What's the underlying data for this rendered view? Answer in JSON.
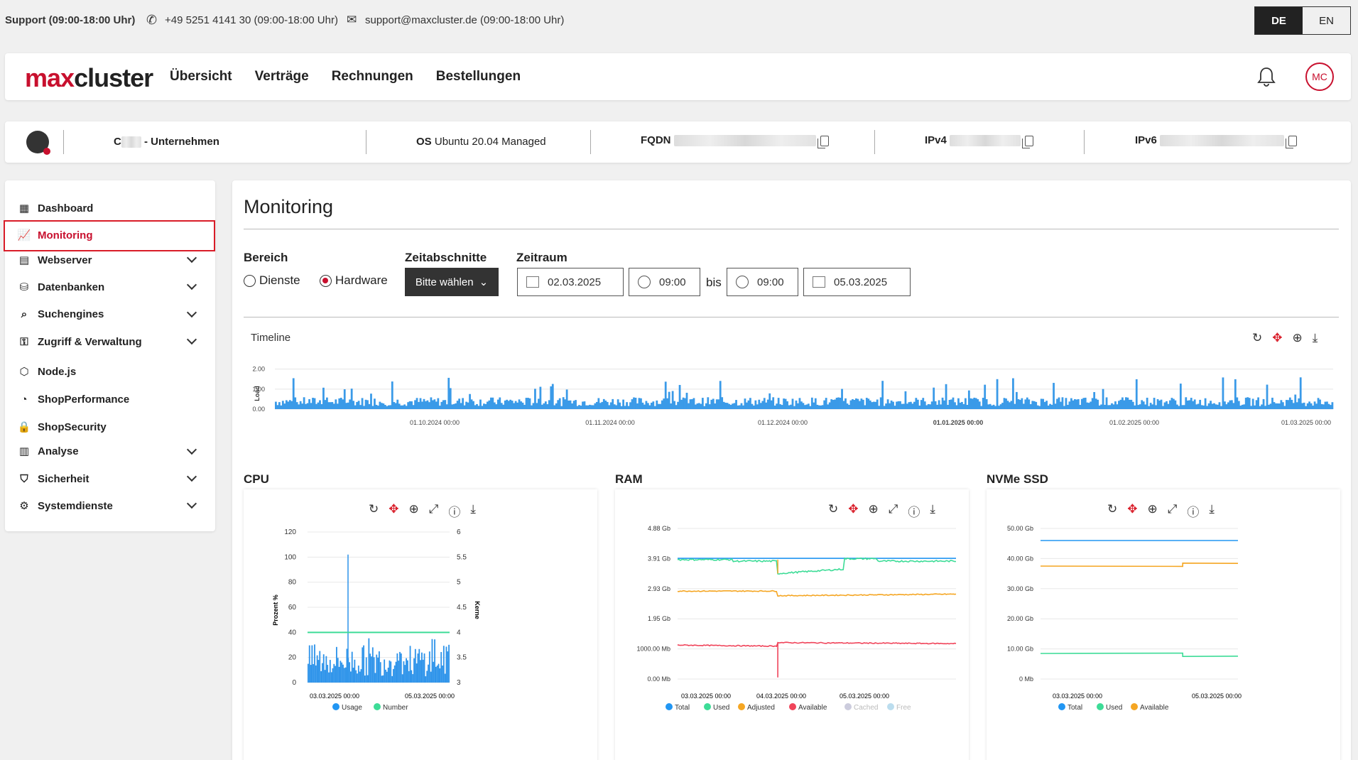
{
  "topbar": {
    "support": "Support (09:00-18:00 Uhr)",
    "phone": "+49 5251 4141 30 (09:00-18:00 Uhr)",
    "email": "support@maxcluster.de (09:00-18:00 Uhr)",
    "lang_de": "DE",
    "lang_en": "EN"
  },
  "header": {
    "logo_max": "max",
    "logo_cluster": "cluster",
    "nav": [
      "Übersicht",
      "Verträge",
      "Rechnungen",
      "Bestellungen"
    ],
    "avatar": "MC"
  },
  "infobar": {
    "company_prefix": "C",
    "company": "- Unternehmen",
    "os_label": "OS",
    "os_value": "Ubuntu 20.04 Managed",
    "fqdn_label": "FQDN",
    "ipv4_label": "IPv4",
    "ipv6_label": "IPv6"
  },
  "sidebar": {
    "items": [
      {
        "label": "Dashboard",
        "icon": "dashboard-icon"
      },
      {
        "label": "Monitoring",
        "icon": "monitoring-icon",
        "active": true
      },
      {
        "label": "Webserver",
        "icon": "webserver-icon",
        "expandable": true
      },
      {
        "label": "Datenbanken",
        "icon": "database-icon",
        "expandable": true
      },
      {
        "label": "Suchengines",
        "icon": "search-icon",
        "expandable": true
      },
      {
        "label": "Zugriff & Verwaltung",
        "icon": "key-icon",
        "expandable": true
      },
      {
        "label": "Node.js",
        "icon": "nodejs-icon"
      },
      {
        "label": "ShopPerformance",
        "icon": "speedometer-icon"
      },
      {
        "label": "ShopSecurity",
        "icon": "lock-icon"
      },
      {
        "label": "Analyse",
        "icon": "analytics-icon",
        "expandable": true
      },
      {
        "label": "Sicherheit",
        "icon": "shield-icon",
        "expandable": true
      },
      {
        "label": "Systemdienste",
        "icon": "gear-icon",
        "expandable": true
      }
    ]
  },
  "main": {
    "title": "Monitoring",
    "bereich_label": "Bereich",
    "radio_dienste": "Dienste",
    "radio_hardware": "Hardware",
    "selected": "Hardware",
    "zeitabschnitte_label": "Zeitabschnitte",
    "zeitabschnitte_button": "Bitte wählen",
    "zeitraum_label": "Zeitraum",
    "date_from": "02.03.2025",
    "time_from": "09:00",
    "bis": "bis",
    "time_to": "09:00",
    "date_to": "05.03.2025",
    "timeline_title": "Timeline",
    "cpu_title": "CPU",
    "ram_title": "RAM",
    "ssd_title": "NVMe SSD"
  },
  "chart_data": [
    {
      "type": "bar",
      "title": "Timeline",
      "ylabel": "Load",
      "yticks": [
        "2.00",
        "1.00",
        "0.00"
      ],
      "ylim": [
        0,
        2.2
      ],
      "xticks": [
        "01.10.2024 00:00",
        "01.11.2024 00:00",
        "01.12.2024 00:00",
        "01.01.2025 00:00",
        "01.02.2025 00:00",
        "01.03.2025 00:00"
      ],
      "typical_range": [
        0.15,
        0.6
      ],
      "peaks": [
        1.4,
        1.5,
        1.3,
        1.45,
        1.6,
        1.35
      ]
    },
    {
      "type": "bar",
      "title": "CPU",
      "ylabel": "Prozent %",
      "y2label": "Kerne",
      "yticks": [
        "120",
        "100",
        "80",
        "60",
        "40",
        "20",
        "0"
      ],
      "y2ticks": [
        "6",
        "5.5",
        "5",
        "4.5",
        "4",
        "3.5",
        "3"
      ],
      "xticks": [
        "03.03.2025 00:00",
        "05.03.2025 00:00"
      ],
      "series": [
        {
          "name": "Usage",
          "color": "#2196f3",
          "typical": [
            5,
            30
          ],
          "spike": 102
        },
        {
          "name": "Number",
          "color": "#3ddc97",
          "value": 4
        }
      ]
    },
    {
      "type": "line",
      "title": "RAM",
      "yticks": [
        "4.88 Gb",
        "3.91 Gb",
        "2.93 Gb",
        "1.95 Gb",
        "1000.00 Mb",
        "0.00 Mb"
      ],
      "xticks": [
        "03.03.2025 00:00",
        "04.03.2025 00:00",
        "05.03.2025 00:00"
      ],
      "series": [
        {
          "name": "Total",
          "color": "#2196f3",
          "values": [
            3.91,
            3.91
          ]
        },
        {
          "name": "Used",
          "color": "#3ddc97",
          "values": [
            3.87,
            3.82,
            3.4,
            3.55,
            3.85,
            3.8
          ]
        },
        {
          "name": "Adjusted",
          "color": "#f5a623",
          "values": [
            2.85,
            2.85,
            2.7,
            2.72,
            2.75
          ]
        },
        {
          "name": "Available",
          "color": "#f0445a",
          "values": [
            1.1,
            1.05,
            1.2,
            1.15,
            1.15
          ]
        },
        {
          "name": "Cached",
          "color": "#ccd"
        },
        {
          "name": "Free",
          "color": "#bde"
        }
      ]
    },
    {
      "type": "line",
      "title": "NVMe SSD",
      "yticks": [
        "50.00 Gb",
        "40.00 Gb",
        "30.00 Gb",
        "20.00 Gb",
        "10.00 Gb",
        "0 Mb"
      ],
      "xticks": [
        "03.03.2025 00:00",
        "05.03.2025 00:00"
      ],
      "series": [
        {
          "name": "Total",
          "color": "#2196f3",
          "values": [
            46,
            46
          ]
        },
        {
          "name": "Used",
          "color": "#3ddc97",
          "values": [
            8.5,
            8.5,
            7.5
          ]
        },
        {
          "name": "Available",
          "color": "#f5a623",
          "values": [
            37.5,
            37.5,
            38.5
          ]
        }
      ]
    }
  ]
}
